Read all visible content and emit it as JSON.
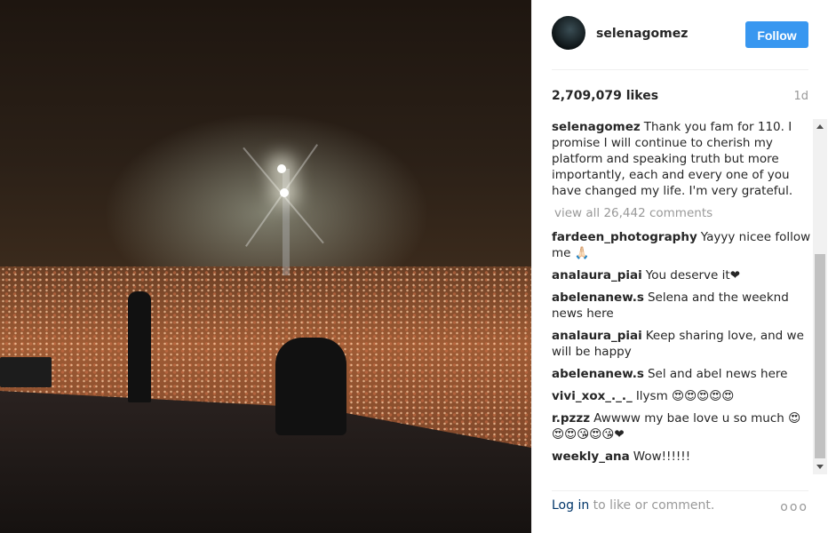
{
  "post": {
    "username": "selenagomez",
    "follow_label": "Follow",
    "likes": "2,709,079 likes",
    "time": "1d",
    "caption": "Thank you fam for 110. I promise I will continue to cherish my platform and speaking truth but more importantly, each and every one of you have changed my life. I'm very grateful.",
    "view_all": "view all 26,442 comments"
  },
  "comments": [
    {
      "user": "fardeen_photography",
      "text": "Yayyy nicee follow me 🙏🏻"
    },
    {
      "user": "analaura_piai",
      "text": "You deserve it❤"
    },
    {
      "user": "abelenanew.s",
      "text": "Selena and the weeknd news here"
    },
    {
      "user": "analaura_piai",
      "text": "Keep sharing love, and we will be happy"
    },
    {
      "user": "abelenanew.s",
      "text": "Sel and abel news here"
    },
    {
      "user": "vivi_xox_._._",
      "text": "Ilysm 😍😍😍😍😍"
    },
    {
      "user": "r.pzzz",
      "text": "Awwww my bae love u so much 😍😍😍😘😍😘❤"
    },
    {
      "user": "weekly_ana",
      "text": "Wow!!!!!!"
    }
  ],
  "footer": {
    "login_link": "Log in",
    "login_text": " to like or comment.",
    "more": "ooo"
  },
  "colors": {
    "follow_button": "#3897f0",
    "link": "#003569",
    "muted": "#999999"
  }
}
